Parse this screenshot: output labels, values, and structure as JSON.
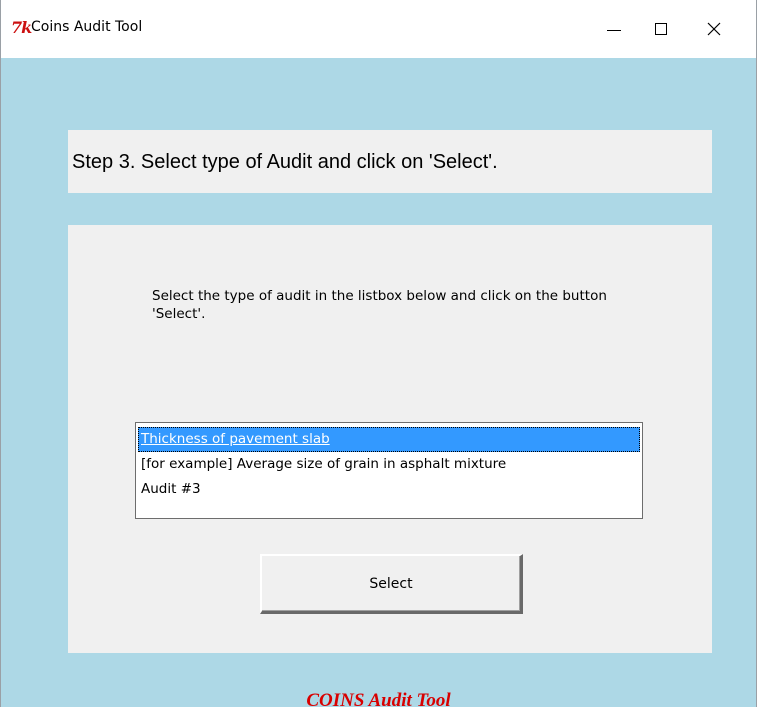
{
  "window": {
    "title": "Coins Audit Tool",
    "icon_text": "7k",
    "close_glyph": "✕"
  },
  "step": {
    "text": "Step 3. Select type of Audit and click on 'Select'."
  },
  "instruction": {
    "text": "Select the type of audit in the listbox below and click on the button 'Select'."
  },
  "listbox": {
    "items": [
      {
        "label": "Thickness of pavement slab",
        "selected": true
      },
      {
        "label": "[for example] Average size of grain in asphalt mixture",
        "selected": false
      },
      {
        "label": "Audit #3",
        "selected": false
      }
    ]
  },
  "buttons": {
    "select_label": "Select"
  },
  "footer": {
    "text": "COINS Audit Tool"
  },
  "colors": {
    "client_background": "#add8e6",
    "panel_background": "#f0f0f0",
    "selection": "#3399ff",
    "footer_text": "#d80000",
    "icon": "#cc1010"
  }
}
